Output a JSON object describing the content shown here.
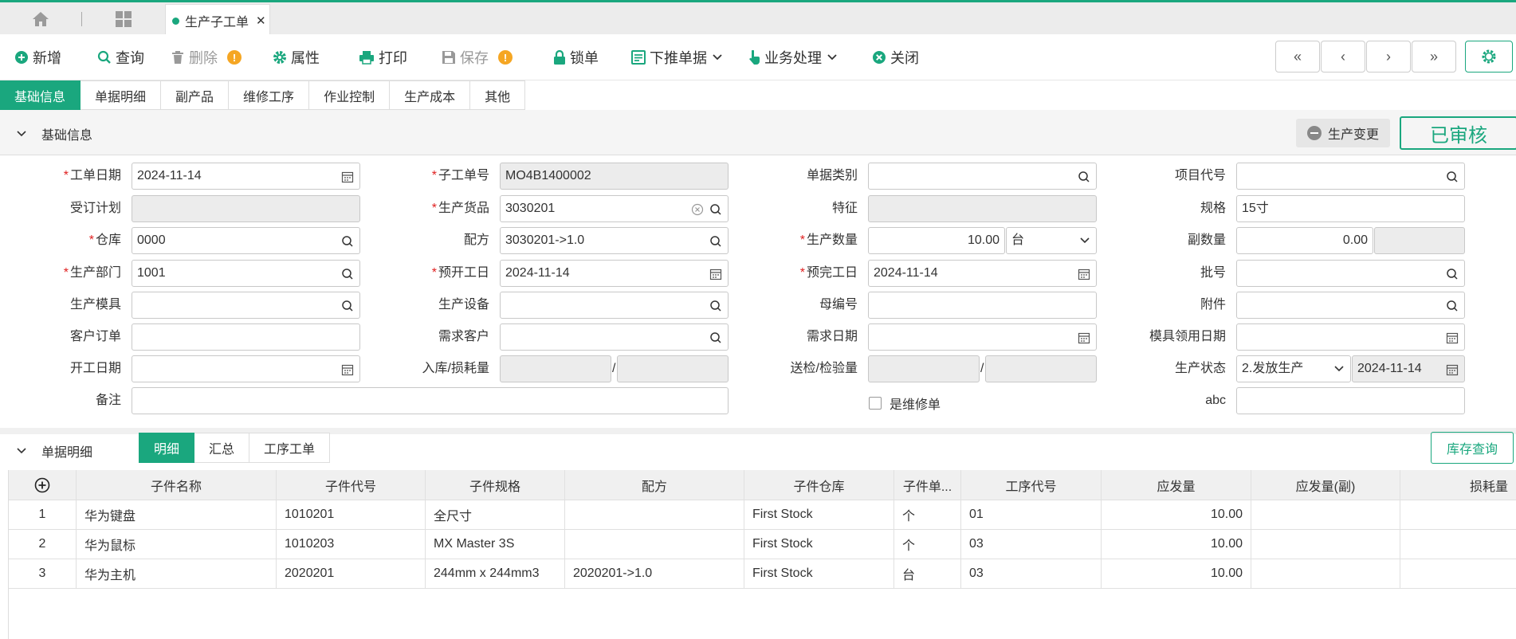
{
  "tabbar": {
    "doc_tab_label": "生产子工单"
  },
  "toolbar": {
    "new": "新增",
    "query": "查询",
    "delete": "删除",
    "property": "属性",
    "print": "打印",
    "save": "保存",
    "lock": "锁单",
    "push_down": "下推单据",
    "business": "业务处理",
    "close": "关闭",
    "warn_mark": "!"
  },
  "tabs": [
    "基础信息",
    "单据明细",
    "副产品",
    "维修工序",
    "作业控制",
    "生产成本",
    "其他"
  ],
  "basic": {
    "section_title": "基础信息",
    "change_button": "生产变更",
    "status": "已审核"
  },
  "form": {
    "work_date": {
      "label": "工单日期",
      "value": "2024-11-14"
    },
    "sub_order_no": {
      "label": "子工单号",
      "value": "MO4B1400002"
    },
    "doc_type": {
      "label": "单据类别",
      "value": ""
    },
    "project_code": {
      "label": "项目代号",
      "value": ""
    },
    "order_plan": {
      "label": "受订计划",
      "value": ""
    },
    "product": {
      "label": "生产货品",
      "value": "3030201"
    },
    "feature": {
      "label": "特征",
      "value": ""
    },
    "spec": {
      "label": "规格",
      "value": "15寸"
    },
    "warehouse": {
      "label": "仓库",
      "value": "0000"
    },
    "formula": {
      "label": "配方",
      "value": "3030201->1.0"
    },
    "quantity": {
      "label": "生产数量",
      "value": "10.00",
      "unit": "台"
    },
    "sub_quantity": {
      "label": "副数量",
      "value": "0.00"
    },
    "department": {
      "label": "生产部门",
      "value": "1001"
    },
    "plan_start": {
      "label": "预开工日",
      "value": "2024-11-14"
    },
    "plan_end": {
      "label": "预完工日",
      "value": "2024-11-14"
    },
    "batch": {
      "label": "批号",
      "value": ""
    },
    "mold": {
      "label": "生产模具",
      "value": ""
    },
    "equipment": {
      "label": "生产设备",
      "value": ""
    },
    "parent_no": {
      "label": "母编号",
      "value": ""
    },
    "attachment": {
      "label": "附件",
      "value": ""
    },
    "customer_order": {
      "label": "客户订单",
      "value": ""
    },
    "demand_customer": {
      "label": "需求客户",
      "value": ""
    },
    "demand_date": {
      "label": "需求日期",
      "value": ""
    },
    "mold_date": {
      "label": "模具领用日期",
      "value": ""
    },
    "start_date": {
      "label": "开工日期",
      "value": ""
    },
    "in_loss": {
      "label": "入库/损耗量",
      "value": "",
      "value2": ""
    },
    "inspect": {
      "label": "送检/检验量",
      "value": "",
      "value2": ""
    },
    "prod_status": {
      "label": "生产状态",
      "value": "2.发放生产",
      "date": "2024-11-14"
    },
    "remark": {
      "label": "备注",
      "value": ""
    },
    "is_repair": {
      "label": "是维修单"
    },
    "abc": {
      "label": "abc",
      "value": ""
    },
    "slash": "/"
  },
  "detail": {
    "section_title": "单据明细",
    "tabs": [
      "明细",
      "汇总",
      "工序工单"
    ],
    "stock_button": "库存查询",
    "columns": [
      "子件名称",
      "子件代号",
      "子件规格",
      "配方",
      "子件仓库",
      "子件单...",
      "工序代号",
      "应发量",
      "应发量(副)",
      "损耗量"
    ],
    "rows": [
      {
        "no": "1",
        "name": "华为键盘",
        "code": "1010201",
        "spec": "全尺寸",
        "formula": "",
        "warehouse": "First Stock",
        "unit": "个",
        "process": "01",
        "qty": "10.00",
        "qty2": "",
        "loss": ""
      },
      {
        "no": "2",
        "name": "华为鼠标",
        "code": "1010203",
        "spec": "MX Master 3S",
        "formula": "",
        "warehouse": "First Stock",
        "unit": "个",
        "process": "03",
        "qty": "10.00",
        "qty2": "",
        "loss": ""
      },
      {
        "no": "3",
        "name": "华为主机",
        "code": "2020201",
        "spec": "244mm x 244mm3",
        "formula": "2020201->1.0",
        "warehouse": "First Stock",
        "unit": "台",
        "process": "03",
        "qty": "10.00",
        "qty2": "",
        "loss": ""
      }
    ]
  }
}
